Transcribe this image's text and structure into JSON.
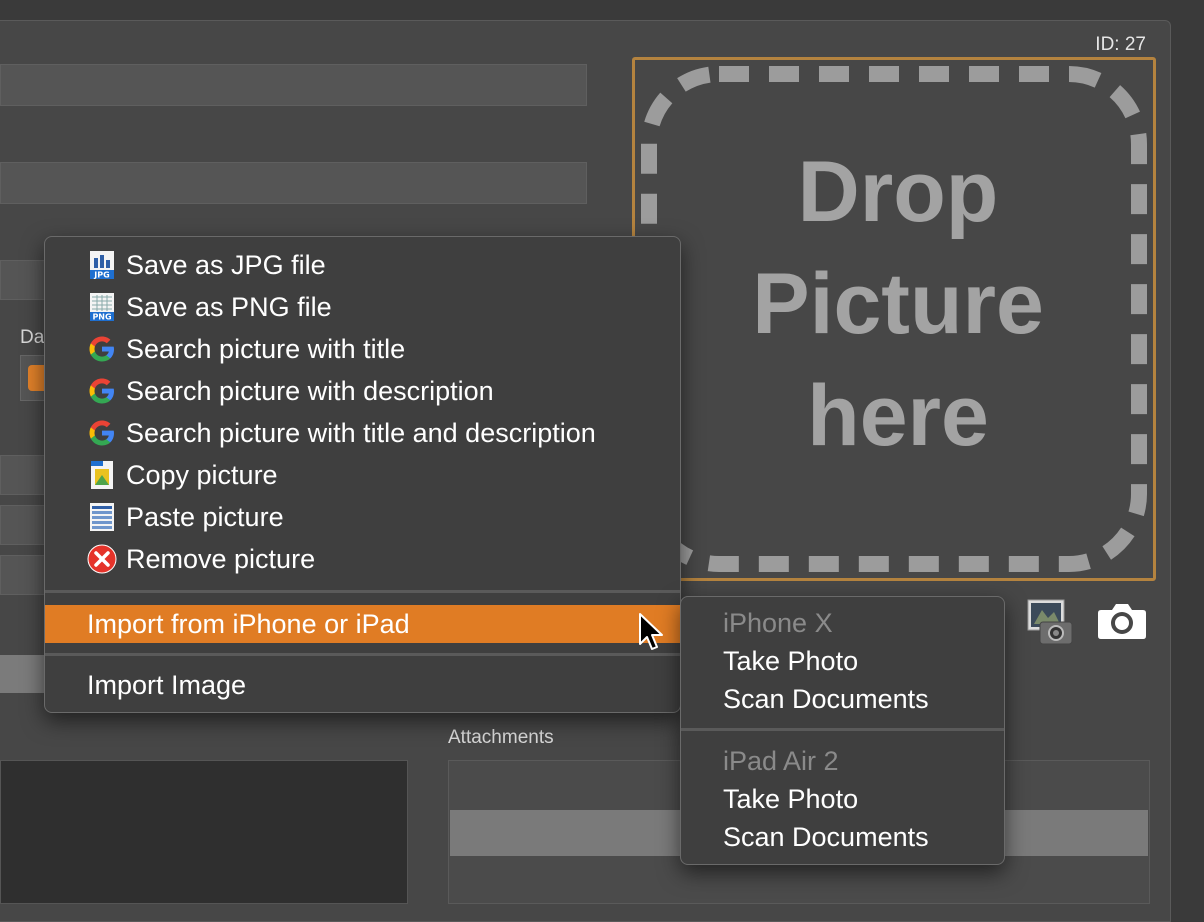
{
  "record": {
    "id_label": "ID: 27"
  },
  "form": {
    "date_label_partial": "Da"
  },
  "dropzone": {
    "lines": [
      "Drop",
      "Picture",
      "here"
    ]
  },
  "attachments": {
    "label": "Attachments"
  },
  "context_menu": {
    "items": [
      {
        "label": "Save as JPG file",
        "icon": "jpg-file-icon"
      },
      {
        "label": "Save as PNG file",
        "icon": "png-file-icon"
      },
      {
        "label": "Search picture with title",
        "icon": "google-icon"
      },
      {
        "label": "Search picture with description",
        "icon": "google-icon"
      },
      {
        "label": "Search picture with title and description",
        "icon": "google-icon"
      },
      {
        "label": "Copy picture",
        "icon": "copy-icon"
      },
      {
        "label": "Paste picture",
        "icon": "paste-icon"
      },
      {
        "label": "Remove picture",
        "icon": "remove-icon"
      }
    ],
    "import_iphone": "Import from iPhone or iPad",
    "import_image": "Import Image",
    "highlight_color": "#e07c24"
  },
  "submenu": {
    "devices": [
      {
        "name": "iPhone X",
        "actions": [
          "Take Photo",
          "Scan Documents"
        ]
      },
      {
        "name": "iPad Air 2",
        "actions": [
          "Take Photo",
          "Scan Documents"
        ]
      }
    ]
  },
  "colors": {
    "drop_border": "#b4833f",
    "accent": "#e07c24"
  }
}
